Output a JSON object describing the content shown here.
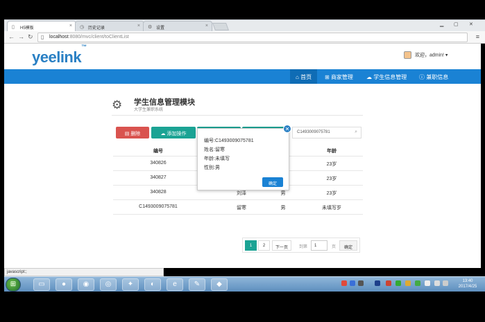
{
  "browser": {
    "tabs": [
      {
        "label": "H5模板"
      },
      {
        "label": "历史记录"
      },
      {
        "label": "设置"
      }
    ],
    "url": {
      "host": "localhost",
      "rest": ":8080/mvc/client/toClientList"
    }
  },
  "site": {
    "logo": "yeelink",
    "logo_tm": "™",
    "user_greeting": "欢迎，admin!",
    "nav": [
      {
        "label": "首页",
        "icon": "home-icon"
      },
      {
        "label": "商家管理",
        "icon": "sitemap-icon"
      },
      {
        "label": "学生信息管理",
        "icon": "cloud-icon"
      },
      {
        "label": "兼职信息",
        "icon": "info-circle-icon"
      }
    ]
  },
  "module": {
    "title": "学生信息管理模块",
    "subtitle": "大学生兼职系统"
  },
  "toolbar": {
    "delete_label": "删除",
    "add_label": "添加操作",
    "search_value": "C1493009075781"
  },
  "table": {
    "headers": [
      "编号",
      "",
      "",
      "年龄"
    ],
    "rows": [
      [
        "340826",
        "",
        "",
        "23岁"
      ],
      [
        "340827",
        "",
        "",
        "23岁"
      ],
      [
        "340828",
        "刘泽",
        "男",
        "23岁"
      ],
      [
        "C1493009075781",
        "留寒",
        "男",
        "未填写岁"
      ]
    ]
  },
  "popup": {
    "lines": [
      "编号:C1493009075781",
      "姓名:留寒",
      "年龄:未填写",
      "性别:男"
    ],
    "ok_label": "确定",
    "close_glyph": "✕"
  },
  "pager": {
    "pages": [
      "1",
      "2"
    ],
    "next_label": "下一页",
    "goto_label": "到第",
    "goto_value": "1",
    "unit_label": "页",
    "go_label": "确定"
  },
  "status": {
    "text": "javascript:;"
  },
  "clock": {
    "time": "13:40",
    "date": "2017/4/25"
  },
  "colors": {
    "brand": "#1a82d4",
    "teal": "#1ba394",
    "danger": "#d9534f"
  }
}
